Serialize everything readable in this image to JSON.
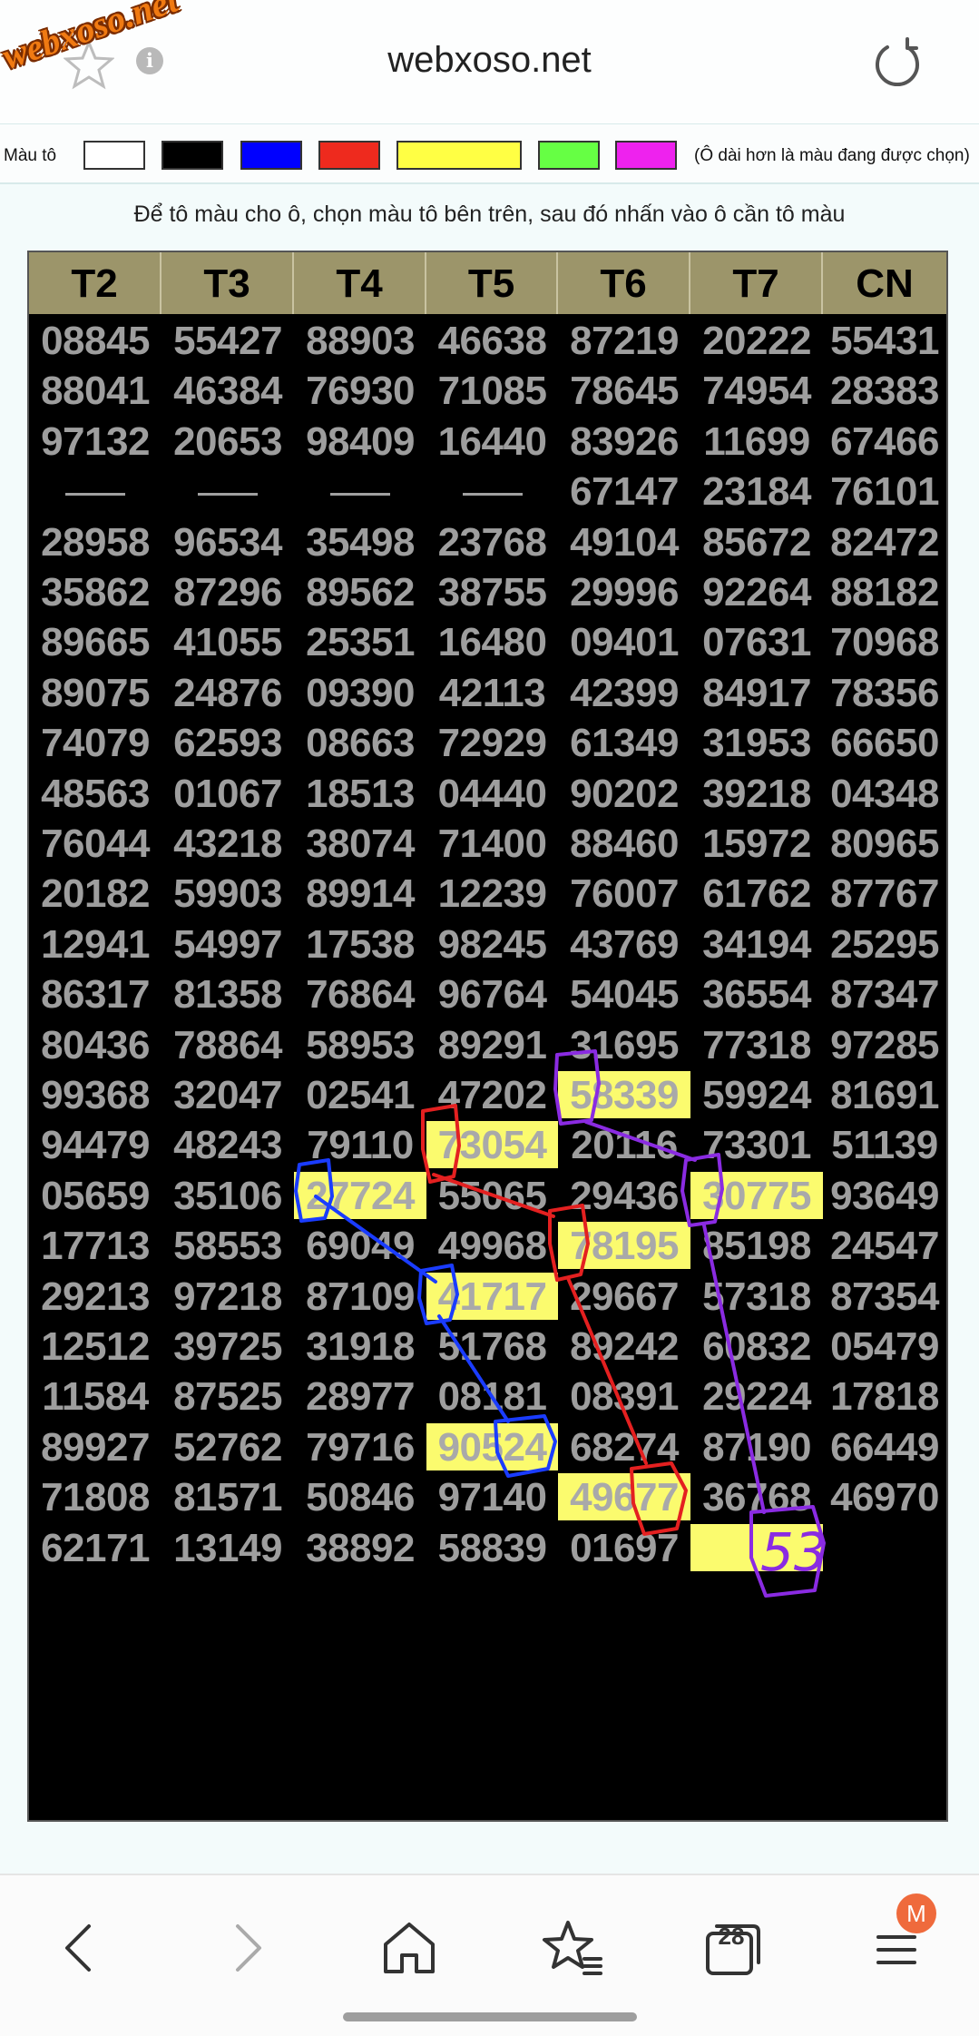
{
  "header": {
    "logo_text": "webxoso.net",
    "title": "webxoso.net",
    "info_glyph": "i"
  },
  "palette": {
    "label": "Màu tô",
    "colors": [
      "#ffffff",
      "#000000",
      "#0000ff",
      "#ee2a1e",
      "#ffff44",
      "#66ff44",
      "#ee22ee"
    ],
    "note": "(Ô dài hơn là màu đang được chọn)"
  },
  "instruction": "Để tô màu cho ô, chọn màu tô bên trên, sau đó nhấn vào ô cần tô màu",
  "table": {
    "headers": [
      "T2",
      "T3",
      "T4",
      "T5",
      "T6",
      "T7",
      "CN"
    ],
    "rows": [
      [
        "08845",
        "55427",
        "88903",
        "46638",
        "87219",
        "20222",
        "55431"
      ],
      [
        "88041",
        "46384",
        "76930",
        "71085",
        "78645",
        "74954",
        "28383"
      ],
      [
        "97132",
        "20653",
        "98409",
        "16440",
        "83926",
        "11699",
        "67466"
      ],
      [
        "—",
        "—",
        "—",
        "—",
        "67147",
        "23184",
        "76101"
      ],
      [
        "28958",
        "96534",
        "35498",
        "23768",
        "49104",
        "85672",
        "82472"
      ],
      [
        "35862",
        "87296",
        "89562",
        "38755",
        "29996",
        "92264",
        "88182"
      ],
      [
        "89665",
        "41055",
        "25351",
        "16480",
        "09401",
        "07631",
        "70968"
      ],
      [
        "89075",
        "24876",
        "09390",
        "42113",
        "42399",
        "84917",
        "78356"
      ],
      [
        "74079",
        "62593",
        "08663",
        "72929",
        "61349",
        "31953",
        "66650"
      ],
      [
        "48563",
        "01067",
        "18513",
        "04440",
        "90202",
        "39218",
        "04348"
      ],
      [
        "76044",
        "43218",
        "38074",
        "71400",
        "88460",
        "15972",
        "80965"
      ],
      [
        "20182",
        "59903",
        "89914",
        "12239",
        "76007",
        "61762",
        "87767"
      ],
      [
        "12941",
        "54997",
        "17538",
        "98245",
        "43769",
        "34194",
        "25295"
      ],
      [
        "86317",
        "81358",
        "76864",
        "96764",
        "54045",
        "36554",
        "87347"
      ],
      [
        "80436",
        "78864",
        "58953",
        "89291",
        "31695",
        "77318",
        "97285"
      ],
      [
        "99368",
        "32047",
        "02541",
        "47202",
        "58339",
        "59924",
        "81691"
      ],
      [
        "94479",
        "48243",
        "79110",
        "73054",
        "20116",
        "73301",
        "51139"
      ],
      [
        "05659",
        "35106",
        "27724",
        "55065",
        "29436",
        "30775",
        "93649"
      ],
      [
        "17713",
        "58553",
        "69049",
        "49968",
        "78195",
        "85198",
        "24547"
      ],
      [
        "29213",
        "97218",
        "87109",
        "41717",
        "29667",
        "57318",
        "87354"
      ],
      [
        "12512",
        "39725",
        "31918",
        "51768",
        "89242",
        "60832",
        "05479"
      ],
      [
        "11584",
        "87525",
        "28977",
        "08181",
        "08391",
        "29224",
        "17818"
      ],
      [
        "89927",
        "52762",
        "79716",
        "90524",
        "68274",
        "87190",
        "66449"
      ],
      [
        "71808",
        "81571",
        "50846",
        "97140",
        "49677",
        "36768",
        "46970"
      ],
      [
        "62171",
        "13149",
        "38892",
        "58839",
        "01697",
        "",
        ""
      ]
    ],
    "highlighted": [
      [
        15,
        4
      ],
      [
        16,
        3
      ],
      [
        17,
        2
      ],
      [
        17,
        5
      ],
      [
        18,
        4
      ],
      [
        19,
        3
      ],
      [
        22,
        3
      ],
      [
        23,
        4
      ],
      [
        24,
        5
      ]
    ]
  },
  "annotations": {
    "handwritten_number": "53"
  },
  "bottom_nav": {
    "tab_count": "28",
    "profile_initial": "M"
  }
}
